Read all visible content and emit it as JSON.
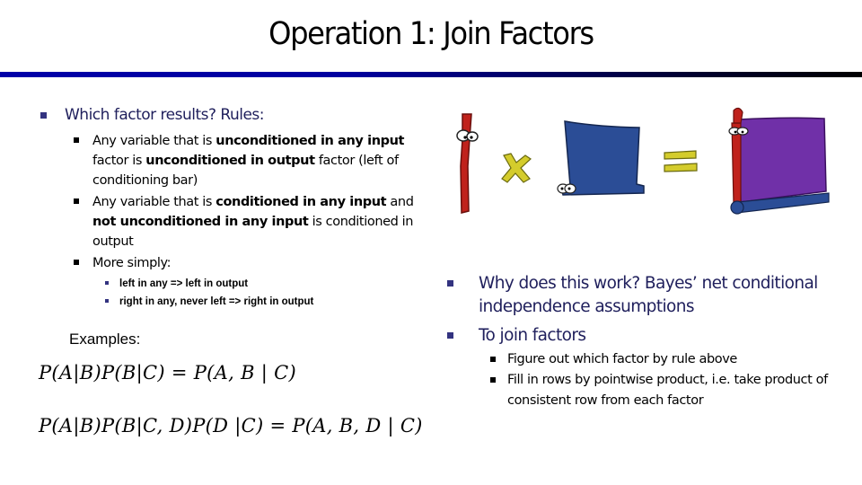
{
  "slide": {
    "title": "Operation 1: Join Factors",
    "theme_colors": {
      "rule_start": "#0000a8",
      "rule_end": "#000000",
      "level1_text": "#1f1f5c",
      "bullet": "#333380"
    }
  },
  "left": {
    "heading": "Which factor results? Rules:",
    "rules": [
      {
        "parts": [
          {
            "t": "Any variable that is ",
            "bold": false
          },
          {
            "t": "unconditioned in any input",
            "bold": true
          },
          {
            "t": " factor is ",
            "bold": false
          },
          {
            "t": "unconditioned in output",
            "bold": true
          },
          {
            "t": " factor (left of conditioning bar)",
            "bold": false
          }
        ]
      },
      {
        "parts": [
          {
            "t": "Any variable that is ",
            "bold": false
          },
          {
            "t": "conditioned in any input",
            "bold": true
          },
          {
            "t": " and ",
            "bold": false
          },
          {
            "t": "not unconditioned in any input",
            "bold": true
          },
          {
            "t": " is conditioned in output",
            "bold": false
          }
        ]
      }
    ],
    "simply_label": "More simply:",
    "simply_items": [
      "left in any => left in output",
      "right in any, never left => right in output"
    ],
    "examples_label": "Examples:",
    "equations": [
      "P(A|B)P(B|C) = P(A, B | C)",
      "P(A|B)P(B|C, D)P(D |C) = P(A, B, D | C)"
    ]
  },
  "illustration": {
    "items": [
      {
        "name": "red-variable-character",
        "color": "#c0221c"
      },
      {
        "name": "times-symbol",
        "glyph": "×",
        "color": "#d8d030"
      },
      {
        "name": "blue-factor-character",
        "color": "#2b4d96"
      },
      {
        "name": "equals-symbol",
        "glyph": "=",
        "color": "#d8d030"
      },
      {
        "name": "purple-joined-factor-character",
        "color": "#7030a8"
      }
    ]
  },
  "right": {
    "bullets": [
      {
        "text": "Why does this work? Bayes’ net conditional independence assumptions"
      },
      {
        "text": "To join factors"
      }
    ],
    "sub_bullets": [
      "Figure out which factor by rule above",
      "Fill in rows by pointwise product, i.e. take product of consistent row from each factor"
    ]
  }
}
